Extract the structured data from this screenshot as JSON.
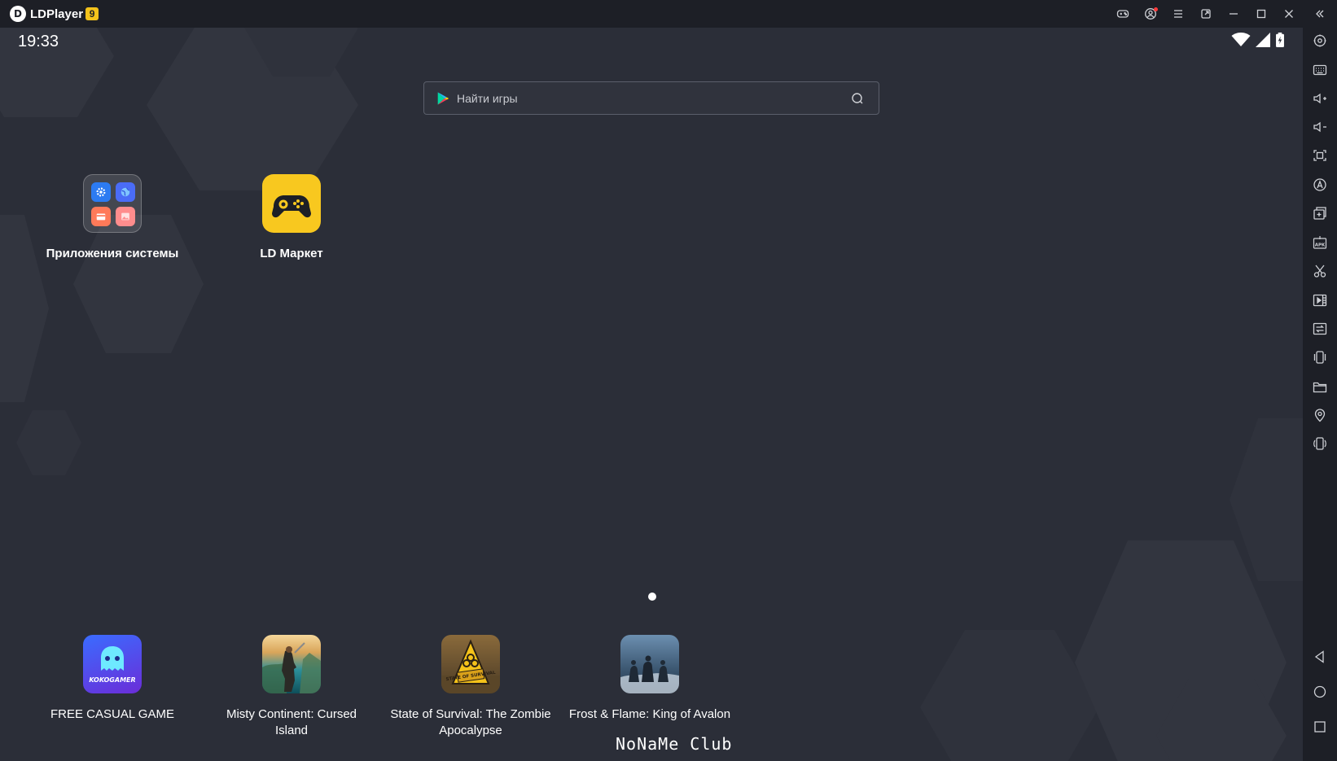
{
  "titlebar": {
    "app_name": "LDPlayer",
    "version_badge": "9",
    "logo_letter": "D",
    "controls": [
      "gamepad-icon",
      "account-icon",
      "menu-icon",
      "external-window-icon",
      "minimize-icon",
      "maximize-icon",
      "close-icon",
      "collapse-sidebar-icon"
    ]
  },
  "status_bar": {
    "time": "19:33",
    "icons": [
      "wifi-icon",
      "signal-icon",
      "battery-charging-icon"
    ]
  },
  "search": {
    "placeholder": "Найти игры"
  },
  "desktop_apps": [
    {
      "label": "Приложения системы",
      "icon": "system-apps-folder-icon"
    },
    {
      "label": "LD Маркет",
      "icon": "ld-market-icon"
    }
  ],
  "dock_apps": [
    {
      "label": "FREE CASUAL GAME",
      "icon": "kokogamer-icon",
      "icon_text": "KOKOGAMER"
    },
    {
      "label": "Misty Continent: Cursed Island",
      "icon": "misty-continent-icon"
    },
    {
      "label": "State of Survival: The Zombie Apocalypse",
      "icon": "state-of-survival-icon",
      "icon_text": "STATE OF SURVIVAL"
    },
    {
      "label": "Frost & Flame: King of Avalon",
      "icon": "frost-flame-icon"
    }
  ],
  "watermark": "NoNaMe Club",
  "sidebar_tools": [
    "settings-icon",
    "keyboard-icon",
    "volume-up-icon",
    "volume-down-icon",
    "screenshot-icon",
    "auto-click-icon",
    "add-instance-icon",
    "apk-install-icon",
    "scissors-icon",
    "record-video-icon",
    "sync-icon",
    "shake-icon",
    "folder-icon",
    "location-icon",
    "rotate-icon"
  ],
  "nav_buttons": [
    "back-icon",
    "home-icon",
    "recents-icon"
  ],
  "colors": {
    "titlebar_bg": "#1d1f26",
    "screen_bg": "#2b2e38",
    "ld_market_yellow": "#f8c81f",
    "version_badge_yellow": "#f3c21b"
  }
}
